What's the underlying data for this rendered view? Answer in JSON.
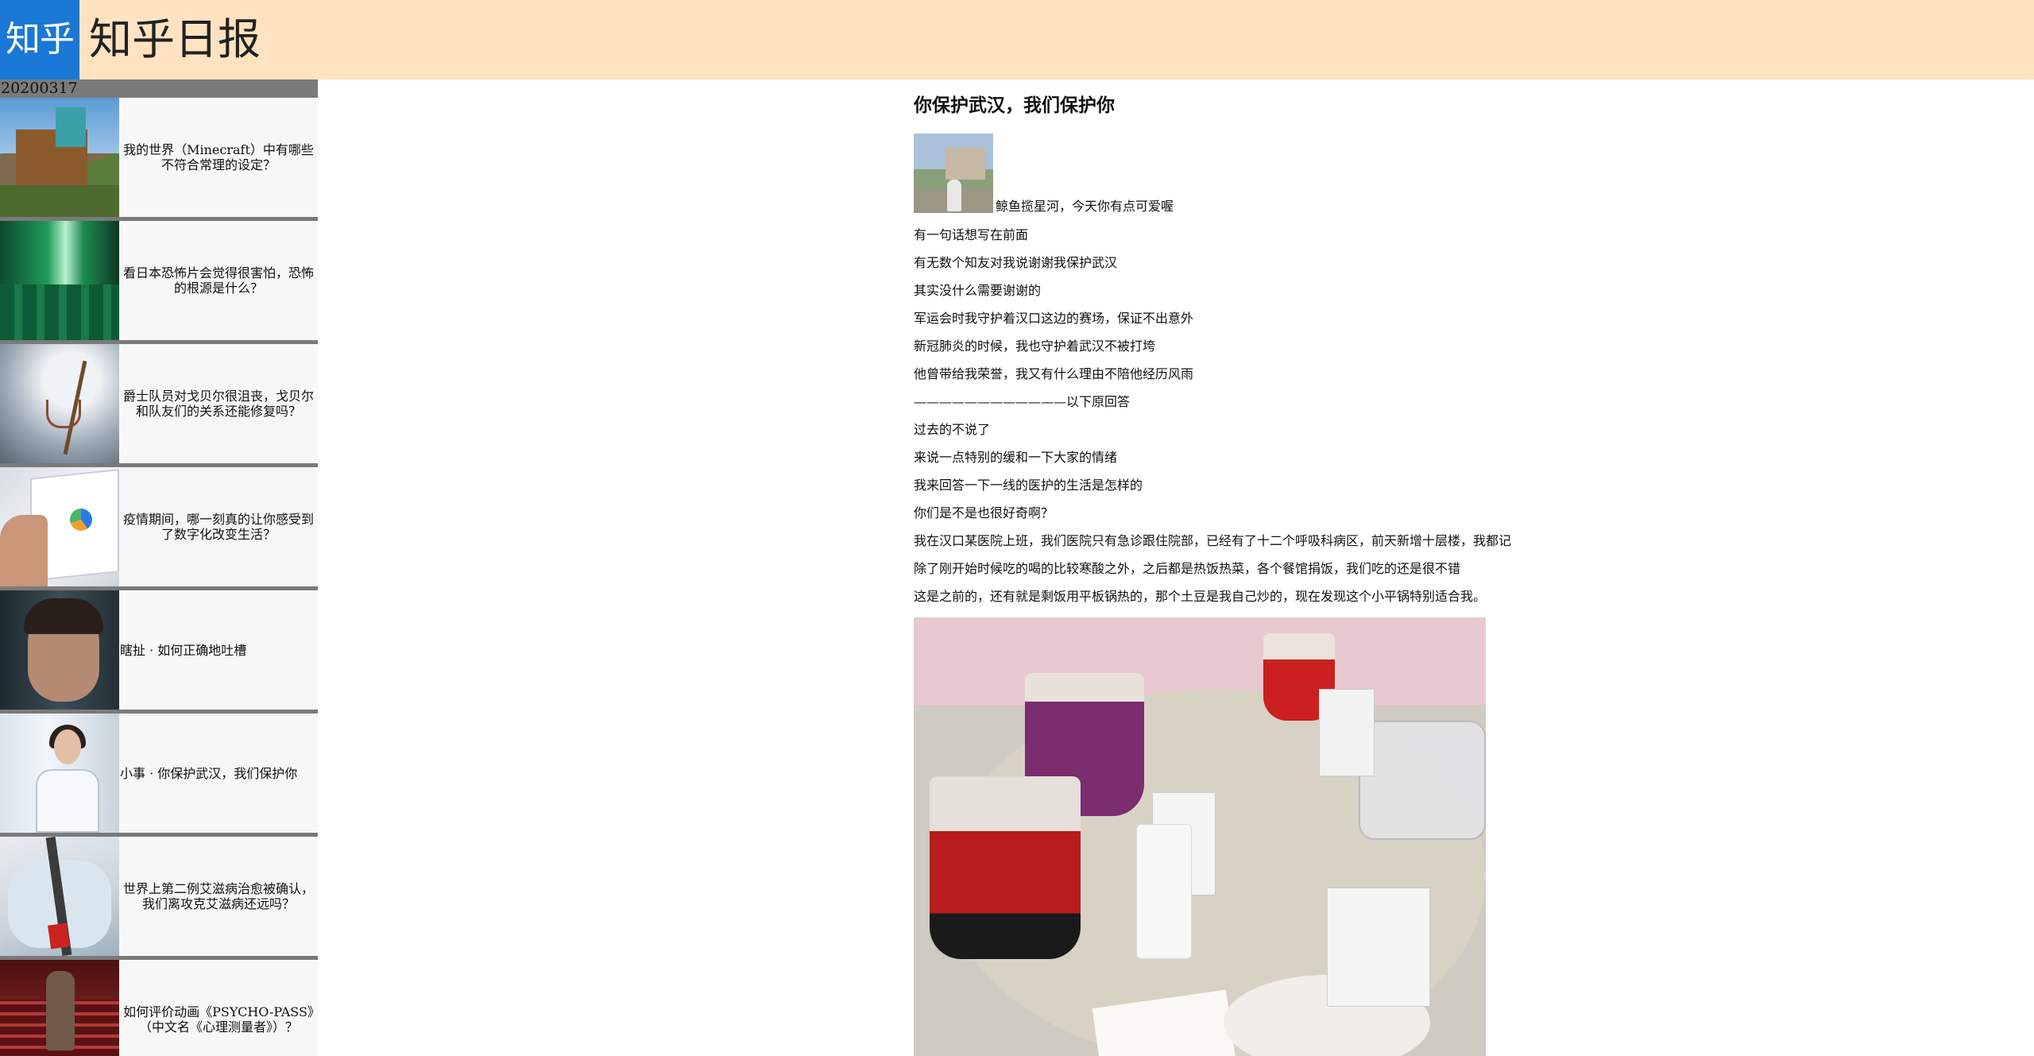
{
  "header": {
    "logo_text": "知乎",
    "title": "知乎日报"
  },
  "sidebar": {
    "date": "20200317",
    "stories": [
      {
        "title": "我的世界（Minecraft）中有哪些不符合常理的设定？",
        "thumb": "minecraft-rider-thumbnail"
      },
      {
        "title": "看日本恐怖片会觉得很害怕，恐怖的根源是什么？",
        "thumb": "green-train-interior-thumbnail"
      },
      {
        "title": "爵士队员对戈贝尔很沮丧，戈贝尔和队友们的关系还能修复吗？",
        "thumb": "basketball-hoop-thumbnail"
      },
      {
        "title": "疫情期间，哪一刻真的让你感受到了数字化改变生活？",
        "thumb": "tablet-chart-thumbnail"
      },
      {
        "title": "瞎扯 · 如何正确地吐槽",
        "thumb": "man-with-glasses-thumbnail"
      },
      {
        "title": "小事 · 你保护武汉，我们保护你",
        "thumb": "nurse-portrait-thumbnail"
      },
      {
        "title": "世界上第二例艾滋病治愈被确认，我们离攻克艾滋病还远吗？",
        "thumb": "test-tube-thumbnail"
      },
      {
        "title": "如何评价动画《PSYCHO-PASS》（中文名《心理测量者》）？",
        "thumb": "anime-theater-thumbnail"
      }
    ]
  },
  "article": {
    "title": "你保护武汉，我们保护你",
    "author": "鲸鱼揽星河，今天你有点可爱喔",
    "paragraphs": [
      "有一句话想写在前面",
      "有无数个知友对我说谢谢我保护武汉",
      "其实没什么需要谢谢的",
      "军运会时我守护着汉口这边的赛场，保证不出意外",
      "新冠肺炎的时候，我也守护着武汉不被打垮",
      "他曾带给我荣誉，我又有什么理由不陪他经历风雨",
      "————————————以下原回答",
      "过去的不说了",
      "来说一点特别的缓和一下大家的情绪",
      "我来回答一下一线的医护的生活是怎样的",
      "你们是不是也很好奇啊？",
      "我在汉口某医院上班，我们医院只有急诊跟住院部，已经有了十二个呼吸科病区，前天新增十层楼，我都记",
      "除了刚开始时候吃的喝的比较寒酸之外，之后都是热饭热菜，各个餐馆捐饭，我们吃的还是很不错",
      "这是之前的，还有就是剩饭用平板锅热的，那个土豆是我自己炒的，现在发现这个小平锅特别适合我。"
    ],
    "photo": "meal-on-table-photo"
  }
}
